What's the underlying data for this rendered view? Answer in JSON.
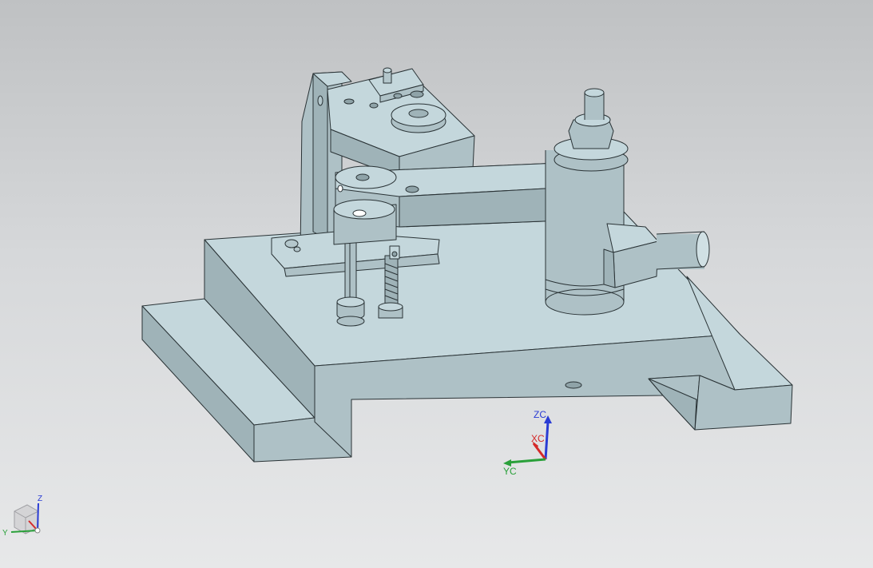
{
  "viewport": {
    "background_top": "#bfc1c3",
    "background_bottom": "#e7e8e9",
    "model_fill": "#b4c7cc",
    "model_top_fill": "#c4d7dc",
    "model_shadow_fill": "#8fa3a8",
    "model_edge": "#2a3336"
  },
  "csys_triad": {
    "z_label": "ZC",
    "x_label": "XC",
    "y_label": "YC",
    "z_color": "#2a3cd4",
    "x_color": "#d42a2a",
    "y_color": "#2aa03a"
  },
  "view_triad": {
    "z_label": "Z",
    "y_label": "Y"
  }
}
